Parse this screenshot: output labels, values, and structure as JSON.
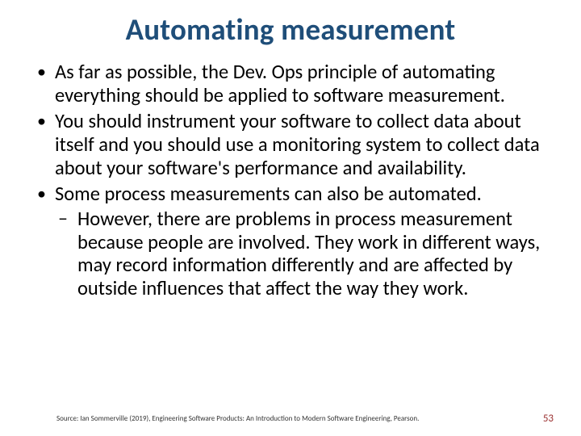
{
  "title": "Automating measurement",
  "bullets": {
    "b1": "As far as possible, the Dev. Ops principle of automating everything should be applied to software measurement.",
    "b2": "You should instrument your software to collect data about itself and you should use a monitoring system to collect data about your software's performance and availability.",
    "b3": "Some process measurements can also be automated.",
    "b3s1": "However, there are problems in process measurement because people are involved. They work in different ways, may record information differently and are affected by outside influences that affect the way they work."
  },
  "footer": {
    "source": "Source: Ian Sommerville (2019), Engineering Software Products: An Introduction to Modern Software Engineering, Pearson.",
    "page": "53"
  }
}
